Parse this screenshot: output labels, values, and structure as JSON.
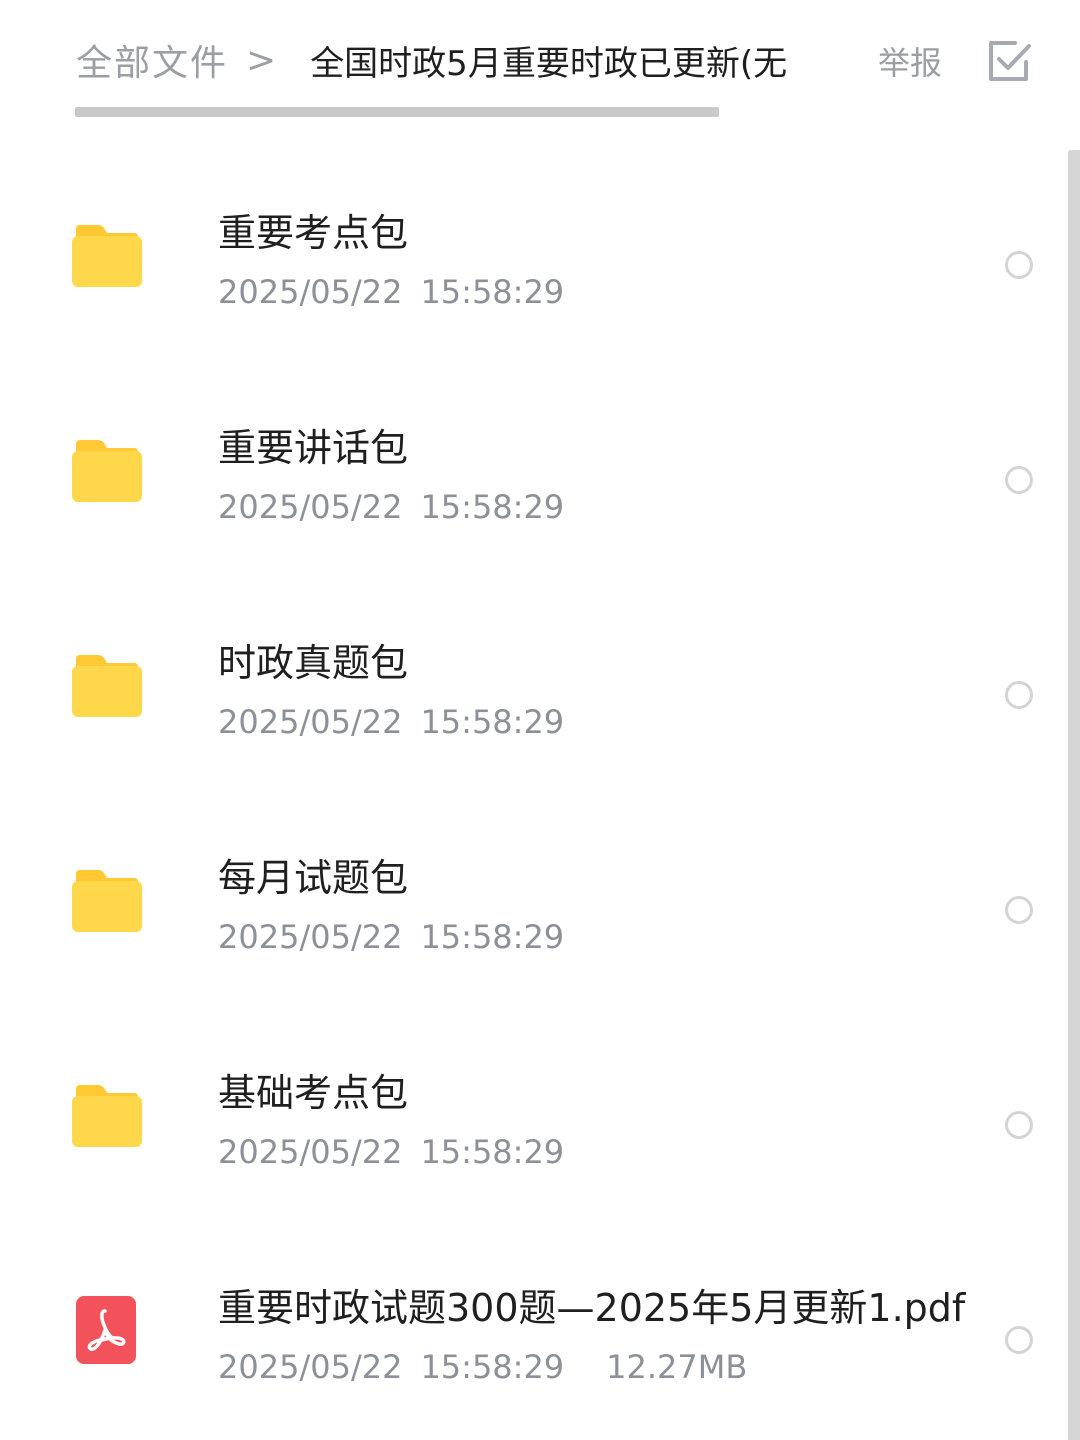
{
  "header": {
    "breadcrumb_root": "全部文件",
    "breadcrumb_separator": ">",
    "breadcrumb_current": "全国时政5月重要时政已更新(无",
    "report_label": "举报"
  },
  "colors": {
    "folder": "#FFD74A",
    "folder_tab": "#FFC934",
    "pdf": "#F4525A"
  },
  "files": [
    {
      "icon": "folder-icon",
      "name": "重要考点包",
      "date": "2025/05/22",
      "time": "15:58:29",
      "size": ""
    },
    {
      "icon": "folder-icon",
      "name": "重要讲话包",
      "date": "2025/05/22",
      "time": "15:58:29",
      "size": ""
    },
    {
      "icon": "folder-icon",
      "name": "时政真题包",
      "date": "2025/05/22",
      "time": "15:58:29",
      "size": ""
    },
    {
      "icon": "folder-icon",
      "name": "每月试题包",
      "date": "2025/05/22",
      "time": "15:58:29",
      "size": ""
    },
    {
      "icon": "folder-icon",
      "name": "基础考点包",
      "date": "2025/05/22",
      "time": "15:58:29",
      "size": ""
    },
    {
      "icon": "pdf-icon",
      "name": "重要时政试题300题—2025年5月更新1.pdf",
      "date": "2025/05/22",
      "time": "15:58:29",
      "size": "12.27MB"
    }
  ]
}
